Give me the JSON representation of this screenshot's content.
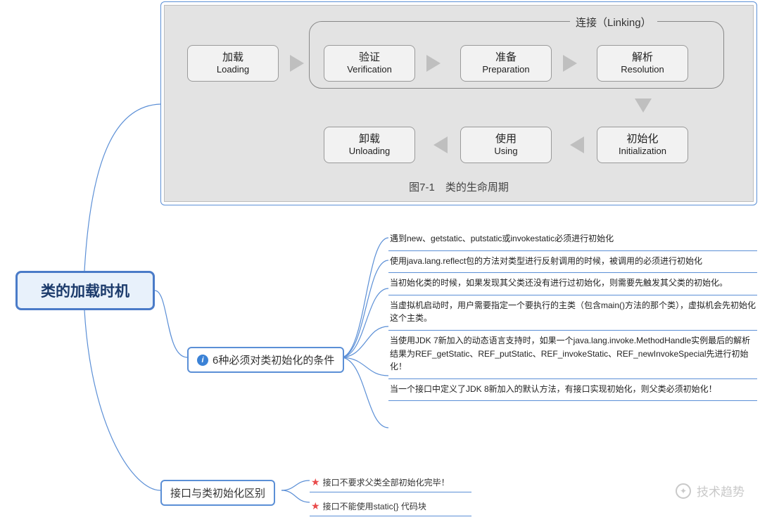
{
  "root": {
    "title": "类的加载时机"
  },
  "lifecycle": {
    "linking_label": "连接（Linking）",
    "stages": {
      "loading": {
        "zh": "加载",
        "en": "Loading"
      },
      "verification": {
        "zh": "验证",
        "en": "Verification"
      },
      "preparation": {
        "zh": "准备",
        "en": "Preparation"
      },
      "resolution": {
        "zh": "解析",
        "en": "Resolution"
      },
      "initialization": {
        "zh": "初始化",
        "en": "Initialization"
      },
      "using": {
        "zh": "使用",
        "en": "Using"
      },
      "unloading": {
        "zh": "卸载",
        "en": "Unloading"
      }
    },
    "caption": "图7-1　类的生命周期"
  },
  "branch1": {
    "label": "6种必须对类初始化的条件",
    "items": [
      "遇到new、getstatic、putstatic或invokestatic必须进行初始化",
      "使用java.lang.reflect包的方法对类型进行反射调用的时候，被调用的必须进行初始化",
      "当初始化类的时候，如果发现其父类还没有进行过初始化，则需要先触发其父类的初始化。",
      "当虚拟机启动时，用户需要指定一个要执行的主类（包含main()方法的那个类），虚拟机会先初始化这个主类。",
      "当使用JDK 7新加入的动态语言支持时，如果一个java.lang.invoke.MethodHandle实例最后的解析结果为REF_getStatic、REF_putStatic、REF_invokeStatic、REF_newInvokeSpecial先进行初始化！",
      "当一个接口中定义了JDK 8新加入的默认方法，有接口实现初始化，则父类必须初始化！"
    ]
  },
  "branch2": {
    "label": "接口与类初始化区别",
    "items": [
      "接口不要求父类全部初始化完毕！",
      "接口不能使用static{} 代码块"
    ]
  },
  "watermark": {
    "text": "技术趋势"
  }
}
